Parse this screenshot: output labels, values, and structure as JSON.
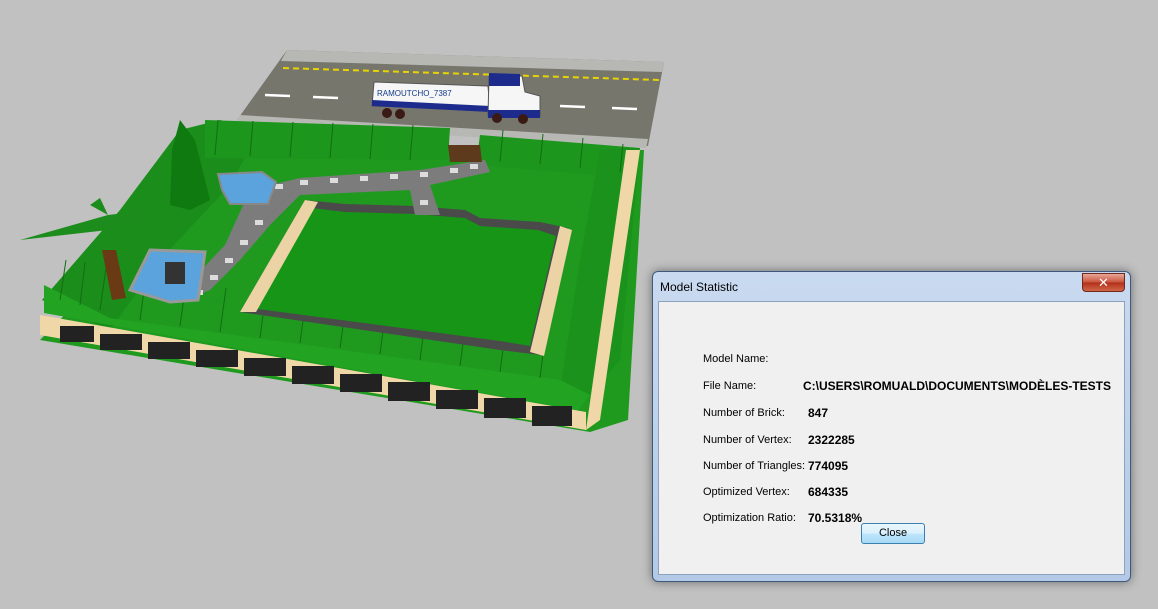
{
  "viewport": {
    "background": "#c1c1c1",
    "scene": "3d-lego-model",
    "truck_label": "RAMOUTCHO_7387"
  },
  "dialog": {
    "title": "Model Statistic",
    "close_glyph": "✕",
    "fields": [
      {
        "label": "Model Name:",
        "value": ""
      },
      {
        "label": "File Name:",
        "value": "C:\\USERS\\ROMUALD\\DOCUMENTS\\MODÈLES-TESTS"
      },
      {
        "label": "Number of Brick:",
        "value": "847"
      },
      {
        "label": "Number of Vertex:",
        "value": "2322285"
      },
      {
        "label": "Number of Triangles:",
        "value": "774095"
      },
      {
        "label": "Optimized Vertex:",
        "value": "684335"
      },
      {
        "label": "Optimization Ratio:",
        "value": "70.5318%"
      }
    ],
    "close_button_label": "Close"
  },
  "colors": {
    "accent": "#3c7fb1",
    "titlebar": "#c9daf0",
    "close_red": "#c8513a",
    "grass": "#1f9a1f",
    "road": "#7a7a70"
  }
}
